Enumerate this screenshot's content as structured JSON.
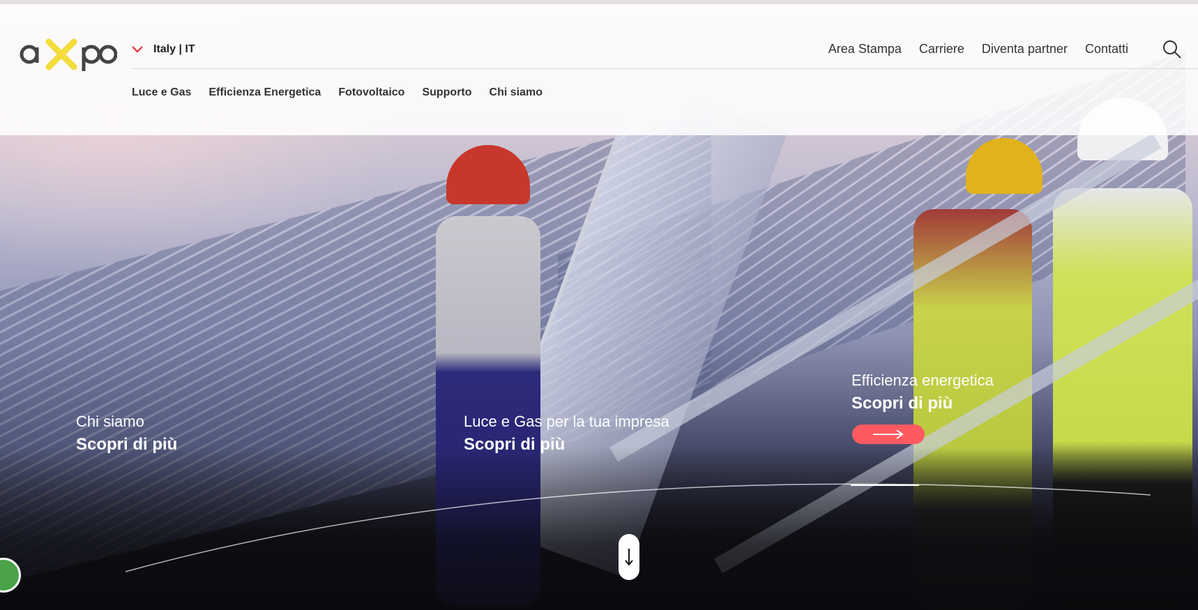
{
  "brand": {
    "logo_text": "axpo",
    "accent_color": "#ff5a5f",
    "logo_x_color": "#f3dd3a"
  },
  "header": {
    "country_selector": {
      "label": "Italy | IT",
      "icon": "chevron-down-icon"
    },
    "utility_links": [
      "Area Stampa",
      "Carriere",
      "Diventa partner",
      "Contatti"
    ],
    "search_icon": "search-icon",
    "main_nav": [
      "Luce e Gas",
      "Efficienza Energetica",
      "Fotovoltaico",
      "Supporto",
      "Chi siamo"
    ]
  },
  "hero": {
    "teasers": [
      {
        "title": "Chi siamo",
        "link": "Scopri di più"
      },
      {
        "title": "Luce e Gas per la tua impresa",
        "link": "Scopri di più"
      },
      {
        "title": "Efficienza energetica",
        "link": "Scopri di più",
        "arrow_icon": "arrow-right-icon"
      }
    ],
    "scroll_icon": "arrow-down-icon",
    "cookie_icon": "cookie-settings-icon"
  }
}
